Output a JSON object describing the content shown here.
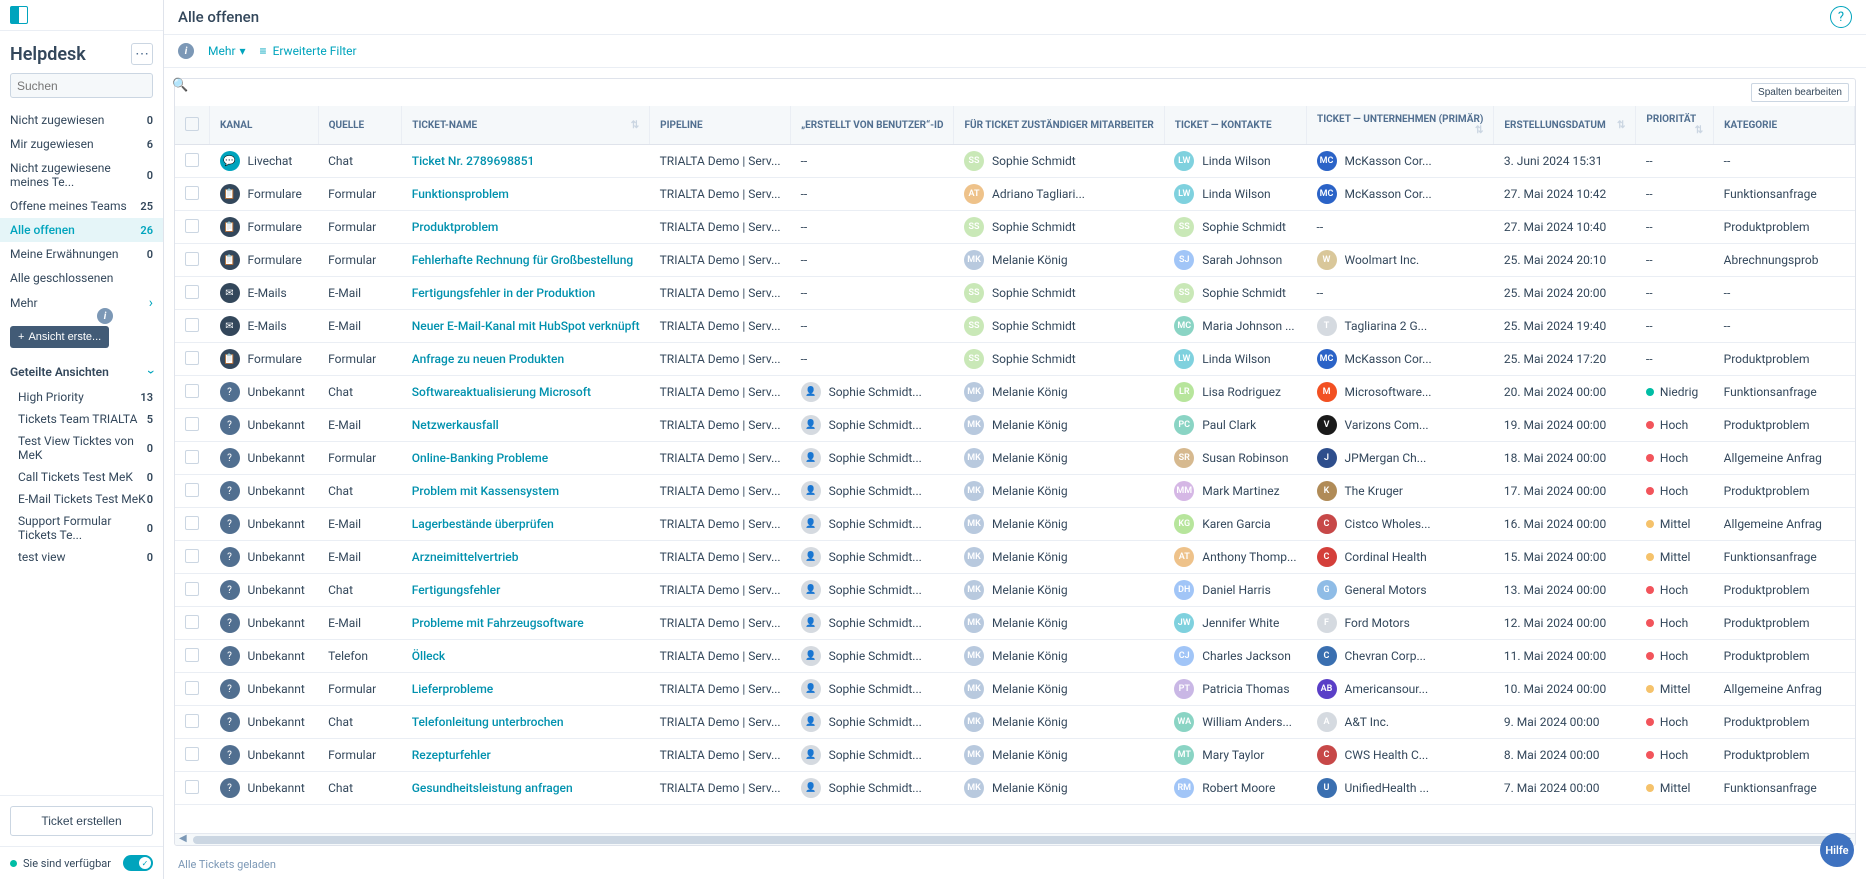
{
  "app": {
    "title": "Helpdesk"
  },
  "sidebar": {
    "search_placeholder": "Suchen",
    "nav": [
      {
        "label": "Nicht zugewiesen",
        "count": "0"
      },
      {
        "label": "Mir zugewiesen",
        "count": "6"
      },
      {
        "label": "Nicht zugewiesene meines Te...",
        "count": "0"
      },
      {
        "label": "Offene meines Teams",
        "count": "25"
      },
      {
        "label": "Alle offenen",
        "count": "26",
        "active": true
      },
      {
        "label": "Meine Erwähnungen",
        "count": "0"
      },
      {
        "label": "Alle geschlossenen",
        "count": ""
      }
    ],
    "more_label": "Mehr",
    "create_view_label": "Ansicht erste...",
    "shared_header": "Geteilte Ansichten",
    "shared": [
      {
        "label": "High Priority",
        "count": "13"
      },
      {
        "label": "Tickets Team TRIALTA",
        "count": "5"
      },
      {
        "label": "Test View Ticktes von MeK",
        "count": "0"
      },
      {
        "label": "Call Tickets Test MeK",
        "count": "0"
      },
      {
        "label": "E-Mail Tickets Test MeK",
        "count": "0"
      },
      {
        "label": "Support Formular Tickets Te...",
        "count": "0"
      },
      {
        "label": "test view",
        "count": "0"
      }
    ],
    "create_ticket_label": "Ticket erstellen",
    "availability_label": "Sie sind verfügbar"
  },
  "header": {
    "view_title": "Alle offenen"
  },
  "toolbar": {
    "more_label": "Mehr",
    "filter_label": "Erweiterte Filter"
  },
  "table": {
    "edit_columns_label": "Spalten bearbeiten",
    "columns": [
      "KANAL",
      "QUELLE",
      "TICKET-NAME",
      "PIPELINE",
      "„ERSTELLT VON BENUTZER“-ID",
      "FÜR TICKET ZUSTÄNDIGER MITARBEITER",
      "TICKET — KONTAKTE",
      "TICKET — UNTERNEHMEN (PRIMÄR)",
      "ERSTELLUNGSDATUM",
      "PRIORITÄT",
      "KATEGORIE"
    ],
    "rows": [
      {
        "kanal": "Livechat",
        "kicon": "chat",
        "quelle": "Chat",
        "name": "Ticket Nr. 2789698851",
        "pipeline": "TRIALTA Demo | Serv...",
        "erstellt": "--",
        "zust": {
          "ini": "SS",
          "name": "Sophie Schmidt",
          "bg": "#c9e8b7"
        },
        "kontakt": {
          "ini": "LW",
          "name": "Linda Wilson",
          "bg": "#7fd1de"
        },
        "unt": {
          "ini": "MC",
          "name": "McKasson Cor...",
          "bg": "#2b63c7"
        },
        "datum": "3. Juni 2024 15:31",
        "prio": "--",
        "kat": "--"
      },
      {
        "kanal": "Formulare",
        "kicon": "form",
        "quelle": "Formular",
        "name": "Funktionsproblem",
        "pipeline": "TRIALTA Demo | Serv...",
        "erstellt": "--",
        "zust": {
          "ini": "AT",
          "name": "Adriano Tagliari...",
          "bg": "#eec28a"
        },
        "kontakt": {
          "ini": "LW",
          "name": "Linda Wilson",
          "bg": "#7fd1de"
        },
        "unt": {
          "ini": "MC",
          "name": "McKasson Cor...",
          "bg": "#2b63c7"
        },
        "datum": "27. Mai 2024 10:42",
        "prio": "--",
        "kat": "Funktionsanfrage"
      },
      {
        "kanal": "Formulare",
        "kicon": "form",
        "quelle": "Formular",
        "name": "Produktproblem",
        "pipeline": "TRIALTA Demo | Serv...",
        "erstellt": "--",
        "zust": {
          "ini": "SS",
          "name": "Sophie Schmidt",
          "bg": "#c9e8b7"
        },
        "kontakt": {
          "ini": "SS",
          "name": "Sophie Schmidt",
          "bg": "#c9e8b7"
        },
        "unt": {
          "ini": "--",
          "name": "--",
          "bg": ""
        },
        "datum": "27. Mai 2024 10:40",
        "prio": "--",
        "kat": "Produktproblem"
      },
      {
        "kanal": "Formulare",
        "kicon": "form",
        "quelle": "Formular",
        "name": "Fehlerhafte Rechnung für Großbestellung",
        "pipeline": "TRIALTA Demo | Serv...",
        "erstellt": "--",
        "zust": {
          "ini": "MK",
          "name": "Melanie König",
          "bg": "#b8c9de"
        },
        "kontakt": {
          "ini": "SJ",
          "name": "Sarah Johnson",
          "bg": "#a1c5f7"
        },
        "unt": {
          "ini": "W",
          "name": "Woolmart Inc.",
          "bg": "#d9c79a"
        },
        "datum": "25. Mai 2024 20:10",
        "prio": "--",
        "kat": "Abrechnungsprob"
      },
      {
        "kanal": "E-Mails",
        "kicon": "email",
        "quelle": "E-Mail",
        "name": "Fertigungsfehler in der Produktion",
        "pipeline": "TRIALTA Demo | Serv...",
        "erstellt": "--",
        "zust": {
          "ini": "SS",
          "name": "Sophie Schmidt",
          "bg": "#c9e8b7"
        },
        "kontakt": {
          "ini": "SS",
          "name": "Sophie Schmidt",
          "bg": "#c9e8b7"
        },
        "unt": {
          "ini": "--",
          "name": "--",
          "bg": ""
        },
        "datum": "25. Mai 2024 20:00",
        "prio": "--",
        "kat": "--"
      },
      {
        "kanal": "E-Mails",
        "kicon": "email",
        "quelle": "E-Mail",
        "name": "Neuer E-Mail-Kanal mit HubSpot verknüpft",
        "pipeline": "TRIALTA Demo | Serv...",
        "erstellt": "--",
        "zust": {
          "ini": "SS",
          "name": "Sophie Schmidt",
          "bg": "#c9e8b7"
        },
        "kontakt": {
          "ini": "MC",
          "name": "Maria Johnson ...",
          "bg": "#8ad4c4"
        },
        "unt": {
          "ini": "T",
          "name": "Tagliarina 2 G...",
          "bg": "#d5dae0"
        },
        "datum": "25. Mai 2024 19:40",
        "prio": "--",
        "kat": "--"
      },
      {
        "kanal": "Formulare",
        "kicon": "form",
        "quelle": "Formular",
        "name": "Anfrage zu neuen Produkten",
        "pipeline": "TRIALTA Demo | Serv...",
        "erstellt": "--",
        "zust": {
          "ini": "SS",
          "name": "Sophie Schmidt",
          "bg": "#c9e8b7"
        },
        "kontakt": {
          "ini": "LW",
          "name": "Linda Wilson",
          "bg": "#7fd1de"
        },
        "unt": {
          "ini": "MC",
          "name": "McKasson Cor...",
          "bg": "#2b63c7"
        },
        "datum": "25. Mai 2024 17:20",
        "prio": "--",
        "kat": "Produktproblem"
      },
      {
        "kanal": "Unbekannt",
        "kicon": "unk",
        "quelle": "Chat",
        "name": "Softwareaktualisierung Microsoft",
        "pipeline": "TRIALTA Demo | Serv...",
        "erstellt": "Sophie Schmidt...",
        "eimg": true,
        "zust": {
          "ini": "MK",
          "name": "Melanie König",
          "bg": "#b8c9de"
        },
        "kontakt": {
          "ini": "LR",
          "name": "Lisa Rodriguez",
          "bg": "#b7e59c"
        },
        "unt": {
          "ini": "M",
          "name": "Microsoftware...",
          "bg": "#f25022"
        },
        "datum": "20. Mai 2024 00:00",
        "prio": "Niedrig",
        "pclass": "low",
        "kat": "Funktionsanfrage"
      },
      {
        "kanal": "Unbekannt",
        "kicon": "unk",
        "quelle": "E-Mail",
        "name": "Netzwerkausfall",
        "pipeline": "TRIALTA Demo | Serv...",
        "erstellt": "Sophie Schmidt...",
        "eimg": true,
        "zust": {
          "ini": "MK",
          "name": "Melanie König",
          "bg": "#b8c9de"
        },
        "kontakt": {
          "ini": "PC",
          "name": "Paul Clark",
          "bg": "#8ad4c4"
        },
        "unt": {
          "ini": "V",
          "name": "Varizons Com...",
          "bg": "#1a1a1a"
        },
        "datum": "19. Mai 2024 00:00",
        "prio": "Hoch",
        "pclass": "high",
        "kat": "Produktproblem"
      },
      {
        "kanal": "Unbekannt",
        "kicon": "unk",
        "quelle": "Formular",
        "name": "Online-Banking Probleme",
        "pipeline": "TRIALTA Demo | Serv...",
        "erstellt": "Sophie Schmidt...",
        "eimg": true,
        "zust": {
          "ini": "MK",
          "name": "Melanie König",
          "bg": "#b8c9de"
        },
        "kontakt": {
          "ini": "SR",
          "name": "Susan Robinson",
          "bg": "#d6b98f"
        },
        "unt": {
          "ini": "J",
          "name": "JPMergan Ch...",
          "bg": "#2e4e8c"
        },
        "datum": "18. Mai 2024 00:00",
        "prio": "Hoch",
        "pclass": "high",
        "kat": "Allgemeine Anfrag"
      },
      {
        "kanal": "Unbekannt",
        "kicon": "unk",
        "quelle": "Chat",
        "name": "Problem mit Kassensystem",
        "pipeline": "TRIALTA Demo | Serv...",
        "erstellt": "Sophie Schmidt...",
        "eimg": true,
        "zust": {
          "ini": "MK",
          "name": "Melanie König",
          "bg": "#b8c9de"
        },
        "kontakt": {
          "ini": "MM",
          "name": "Mark Martinez",
          "bg": "#d5b7e5"
        },
        "unt": {
          "ini": "K",
          "name": "The Kruger",
          "bg": "#b08b57"
        },
        "datum": "17. Mai 2024 00:00",
        "prio": "Hoch",
        "pclass": "high",
        "kat": "Produktproblem"
      },
      {
        "kanal": "Unbekannt",
        "kicon": "unk",
        "quelle": "E-Mail",
        "name": "Lagerbestände überprüfen",
        "pipeline": "TRIALTA Demo | Serv...",
        "erstellt": "Sophie Schmidt...",
        "eimg": true,
        "zust": {
          "ini": "MK",
          "name": "Melanie König",
          "bg": "#b8c9de"
        },
        "kontakt": {
          "ini": "KG",
          "name": "Karen Garcia",
          "bg": "#b7e59c"
        },
        "unt": {
          "ini": "C",
          "name": "Cistco Wholes...",
          "bg": "#c74848"
        },
        "datum": "16. Mai 2024 00:00",
        "prio": "Mittel",
        "pclass": "med",
        "kat": "Allgemeine Anfrag"
      },
      {
        "kanal": "Unbekannt",
        "kicon": "unk",
        "quelle": "E-Mail",
        "name": "Arzneimittelvertrieb",
        "pipeline": "TRIALTA Demo | Serv...",
        "erstellt": "Sophie Schmidt...",
        "eimg": true,
        "zust": {
          "ini": "MK",
          "name": "Melanie König",
          "bg": "#b8c9de"
        },
        "kontakt": {
          "ini": "AT",
          "name": "Anthony Thomp...",
          "bg": "#eec28a"
        },
        "unt": {
          "ini": "C",
          "name": "Cordinal Health",
          "bg": "#d43f3a"
        },
        "datum": "15. Mai 2024 00:00",
        "prio": "Mittel",
        "pclass": "med",
        "kat": "Funktionsanfrage"
      },
      {
        "kanal": "Unbekannt",
        "kicon": "unk",
        "quelle": "Chat",
        "name": "Fertigungsfehler",
        "pipeline": "TRIALTA Demo | Serv...",
        "erstellt": "Sophie Schmidt...",
        "eimg": true,
        "zust": {
          "ini": "MK",
          "name": "Melanie König",
          "bg": "#b8c9de"
        },
        "kontakt": {
          "ini": "DH",
          "name": "Daniel Harris",
          "bg": "#a1c5f7"
        },
        "unt": {
          "ini": "G",
          "name": "General Motors",
          "bg": "#8fbce6"
        },
        "datum": "13. Mai 2024 00:00",
        "prio": "Hoch",
        "pclass": "high",
        "kat": "Produktproblem"
      },
      {
        "kanal": "Unbekannt",
        "kicon": "unk",
        "quelle": "E-Mail",
        "name": "Probleme mit Fahrzeugsoftware",
        "pipeline": "TRIALTA Demo | Serv...",
        "erstellt": "Sophie Schmidt...",
        "eimg": true,
        "zust": {
          "ini": "MK",
          "name": "Melanie König",
          "bg": "#b8c9de"
        },
        "kontakt": {
          "ini": "JW",
          "name": "Jennifer White",
          "bg": "#7fd1de"
        },
        "unt": {
          "ini": "F",
          "name": "Ford Motors",
          "bg": "#d5dae0"
        },
        "datum": "12. Mai 2024 00:00",
        "prio": "Hoch",
        "pclass": "high",
        "kat": "Produktproblem"
      },
      {
        "kanal": "Unbekannt",
        "kicon": "unk",
        "quelle": "Telefon",
        "name": "Ölleck",
        "pipeline": "TRIALTA Demo | Serv...",
        "erstellt": "Sophie Schmidt...",
        "eimg": true,
        "zust": {
          "ini": "MK",
          "name": "Melanie König",
          "bg": "#b8c9de"
        },
        "kontakt": {
          "ini": "CJ",
          "name": "Charles Jackson",
          "bg": "#a1c5f7"
        },
        "unt": {
          "ini": "C",
          "name": "Chevran Corp...",
          "bg": "#3a6fb0"
        },
        "datum": "11. Mai 2024 00:00",
        "prio": "Hoch",
        "pclass": "high",
        "kat": "Produktproblem"
      },
      {
        "kanal": "Unbekannt",
        "kicon": "unk",
        "quelle": "Formular",
        "name": "Lieferprobleme",
        "pipeline": "TRIALTA Demo | Serv...",
        "erstellt": "Sophie Schmidt...",
        "eimg": true,
        "zust": {
          "ini": "MK",
          "name": "Melanie König",
          "bg": "#b8c9de"
        },
        "kontakt": {
          "ini": "PT",
          "name": "Patricia Thomas",
          "bg": "#c9b7e5"
        },
        "unt": {
          "ini": "AB",
          "name": "Americansour...",
          "bg": "#5a3fc7"
        },
        "datum": "10. Mai 2024 00:00",
        "prio": "Mittel",
        "pclass": "med",
        "kat": "Allgemeine Anfrag"
      },
      {
        "kanal": "Unbekannt",
        "kicon": "unk",
        "quelle": "Chat",
        "name": "Telefonleitung unterbrochen",
        "pipeline": "TRIALTA Demo | Serv...",
        "erstellt": "Sophie Schmidt...",
        "eimg": true,
        "zust": {
          "ini": "MK",
          "name": "Melanie König",
          "bg": "#b8c9de"
        },
        "kontakt": {
          "ini": "WA",
          "name": "William Anders...",
          "bg": "#8ad4c4"
        },
        "unt": {
          "ini": "A",
          "name": "A&T Inc.",
          "bg": "#d5dae0"
        },
        "datum": "9. Mai 2024 00:00",
        "prio": "Hoch",
        "pclass": "high",
        "kat": "Produktproblem"
      },
      {
        "kanal": "Unbekannt",
        "kicon": "unk",
        "quelle": "Formular",
        "name": "Rezepturfehler",
        "pipeline": "TRIALTA Demo | Serv...",
        "erstellt": "Sophie Schmidt...",
        "eimg": true,
        "zust": {
          "ini": "MK",
          "name": "Melanie König",
          "bg": "#b8c9de"
        },
        "kontakt": {
          "ini": "MT",
          "name": "Mary Taylor",
          "bg": "#8ad4c4"
        },
        "unt": {
          "ini": "C",
          "name": "CWS Health C...",
          "bg": "#c74848"
        },
        "datum": "8. Mai 2024 00:00",
        "prio": "Hoch",
        "pclass": "high",
        "kat": "Produktproblem"
      },
      {
        "kanal": "Unbekannt",
        "kicon": "unk",
        "quelle": "Chat",
        "name": "Gesundheitsleistung anfragen",
        "pipeline": "TRIALTA Demo | Serv...",
        "erstellt": "Sophie Schmidt...",
        "eimg": true,
        "zust": {
          "ini": "MK",
          "name": "Melanie König",
          "bg": "#b8c9de"
        },
        "kontakt": {
          "ini": "RM",
          "name": "Robert Moore",
          "bg": "#a1c5f7"
        },
        "unt": {
          "ini": "U",
          "name": "UnifiedHealth ...",
          "bg": "#3a6fb0"
        },
        "datum": "7. Mai 2024 00:00",
        "prio": "Mittel",
        "pclass": "med",
        "kat": "Funktionsanfrage"
      }
    ],
    "footer_status": "Alle Tickets geladen"
  },
  "fab_label": "Hilfe"
}
